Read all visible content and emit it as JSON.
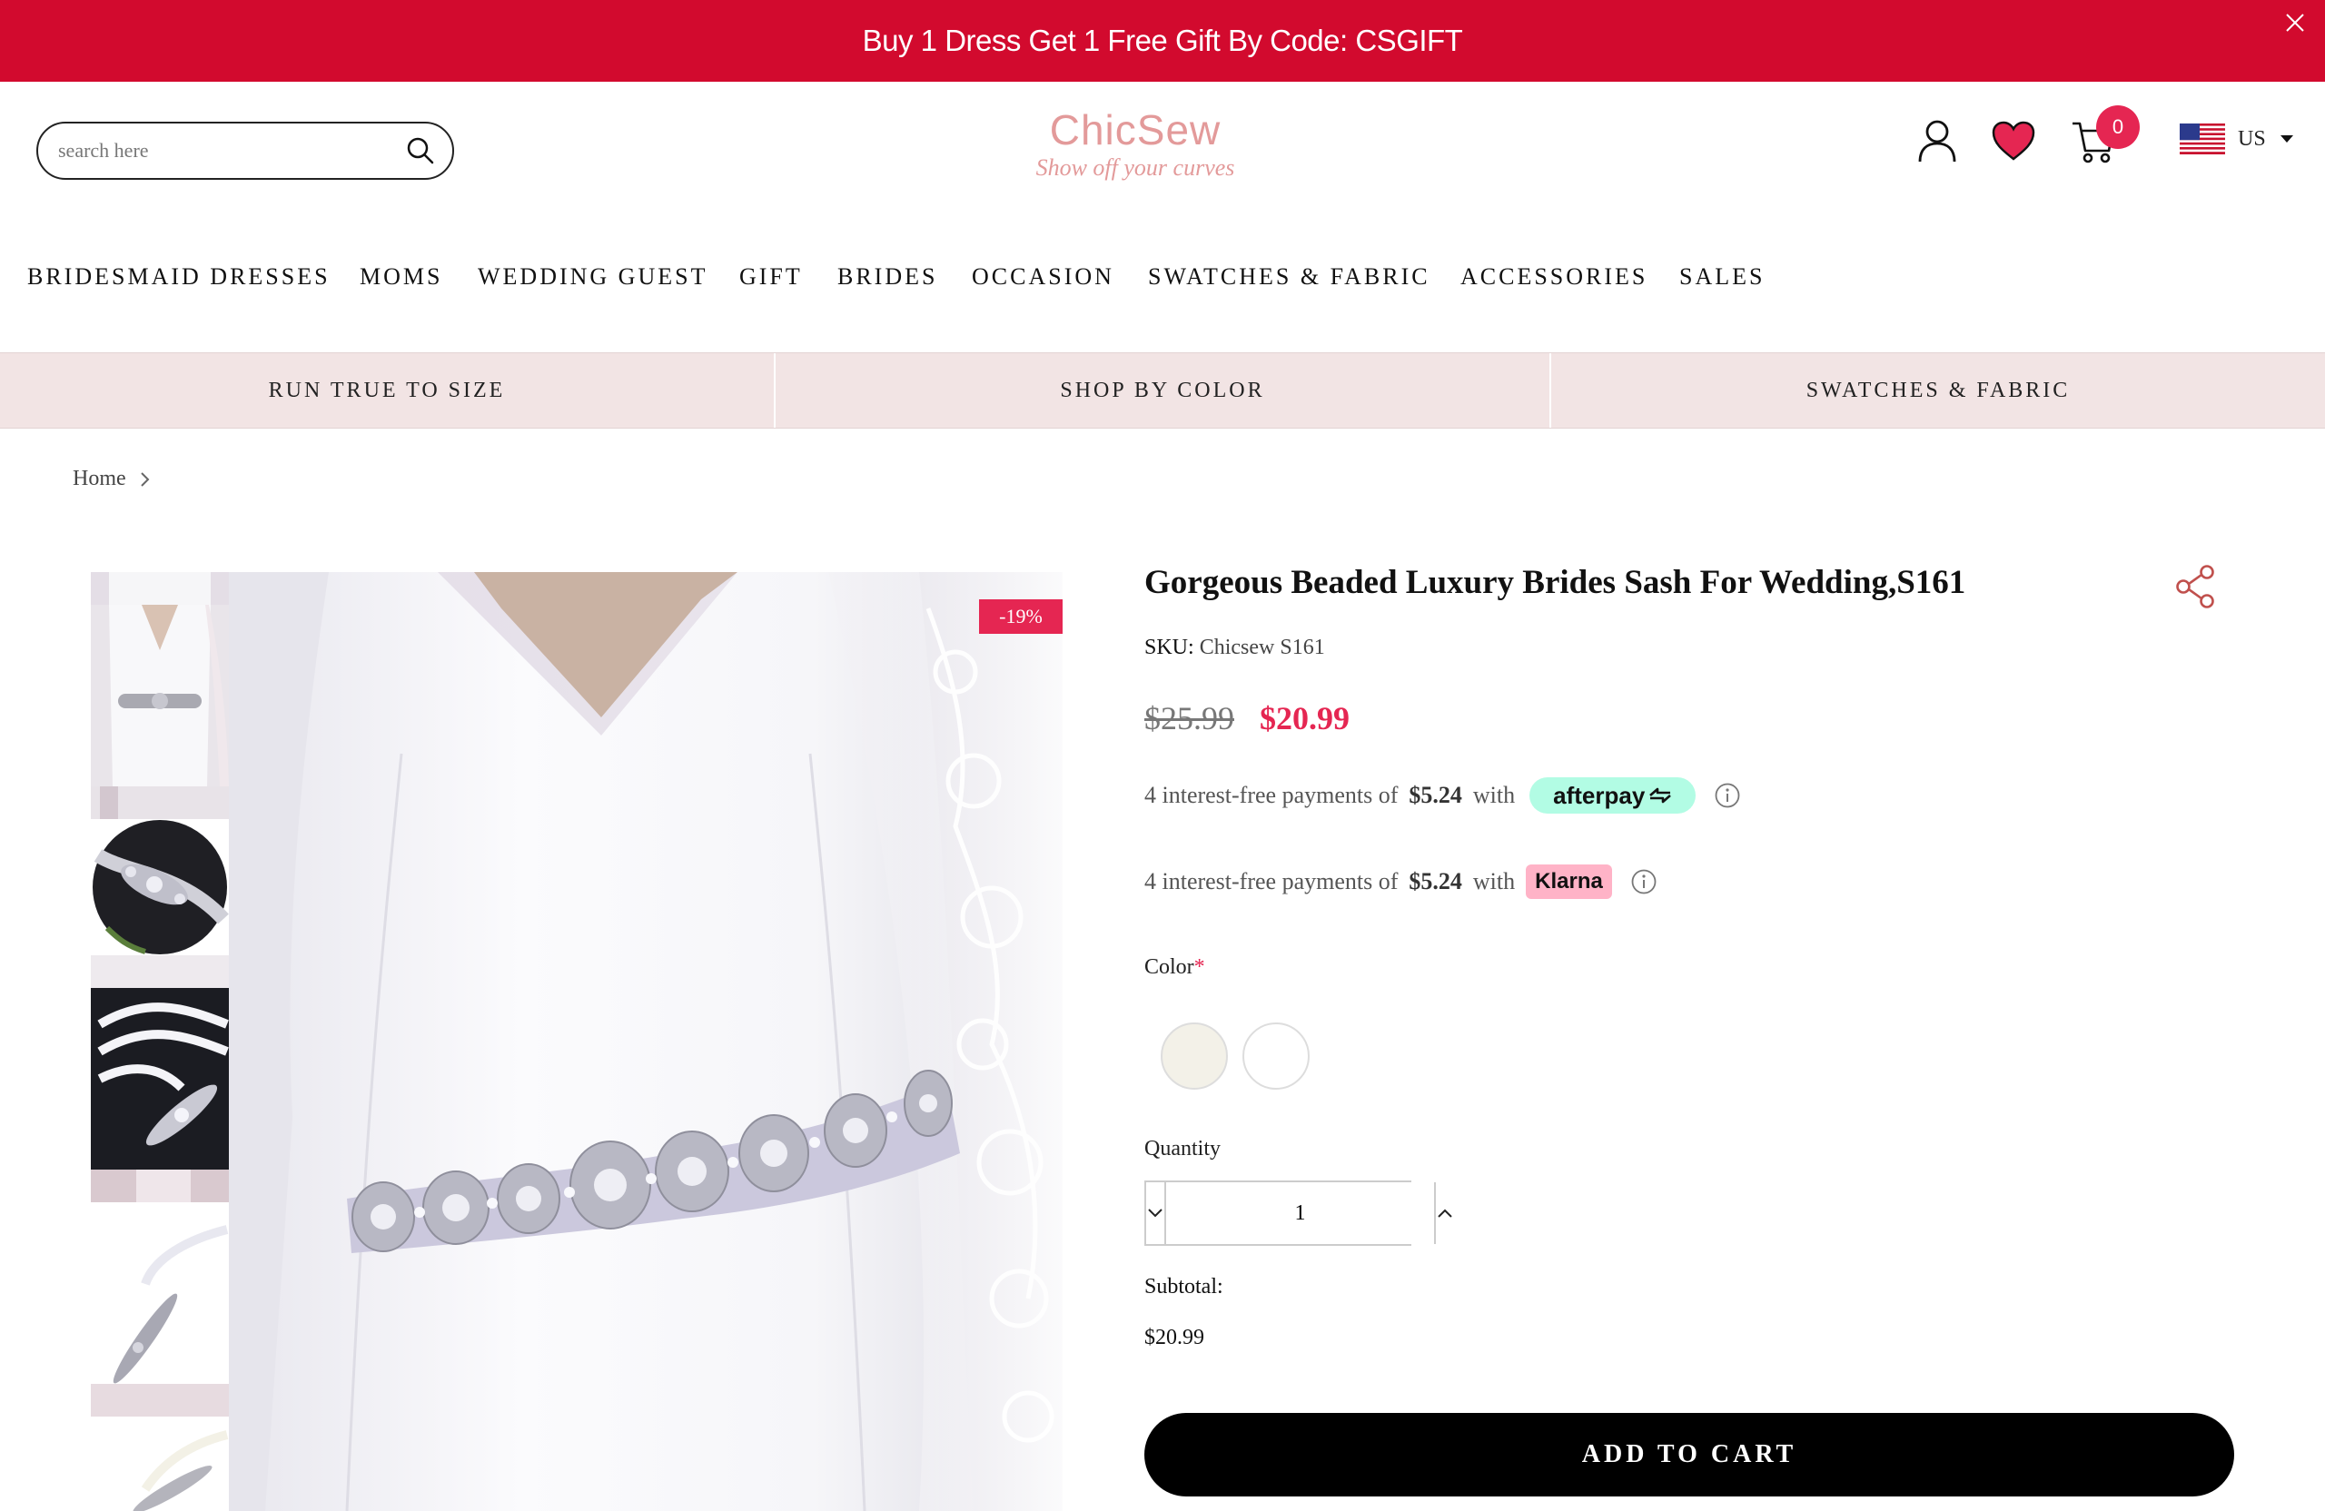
{
  "announcement": {
    "text": "Buy 1 Dress Get 1 Free Gift By Code: CSGIFT"
  },
  "header": {
    "search_placeholder": "search here",
    "logo_main": "ChicSew",
    "logo_tagline": "Show off your curves",
    "cart_count": "0",
    "currency": "US"
  },
  "nav": {
    "items": [
      "BRIDESMAID DRESSES",
      "MOMS",
      "WEDDING GUEST",
      "GIFT",
      "BRIDES",
      "OCCASION",
      "SWATCHES & FABRIC",
      "ACCESSORIES",
      "SALES"
    ]
  },
  "subbar": {
    "items": [
      "RUN TRUE TO SIZE",
      "SHOP BY COLOR",
      "SWATCHES & FABRIC"
    ]
  },
  "breadcrumb": {
    "home": "Home"
  },
  "gallery": {
    "discount": "-19%"
  },
  "product": {
    "title": "Gorgeous Beaded Luxury Brides Sash For Wedding,S161",
    "sku_label": "SKU:",
    "sku_value": "Chicsew S161",
    "price_old": "$25.99",
    "price_new": "$20.99",
    "afterpay": {
      "prefix": "4 interest-free payments of",
      "amount": "$5.24",
      "suffix": "with",
      "brand": "afterpay"
    },
    "klarna": {
      "prefix": "4 interest-free payments of",
      "amount": "$5.24",
      "suffix": "with",
      "brand": "Klarna"
    },
    "color_label": "Color",
    "required_mark": "*",
    "swatch_colors": [
      "#f3f1e8",
      "#ffffff"
    ],
    "quantity_label": "Quantity",
    "quantity": "1",
    "subtotal_label": "Subtotal:",
    "subtotal_value": "$20.99",
    "add_to_cart": "ADD TO CART"
  },
  "colors": {
    "brand_red": "#d20a2e",
    "accent_pink": "#e52652",
    "subbar_bg": "#f2e4e4",
    "afterpay_mint": "#b2fce4",
    "klarna_pink": "#ffb3c7"
  }
}
